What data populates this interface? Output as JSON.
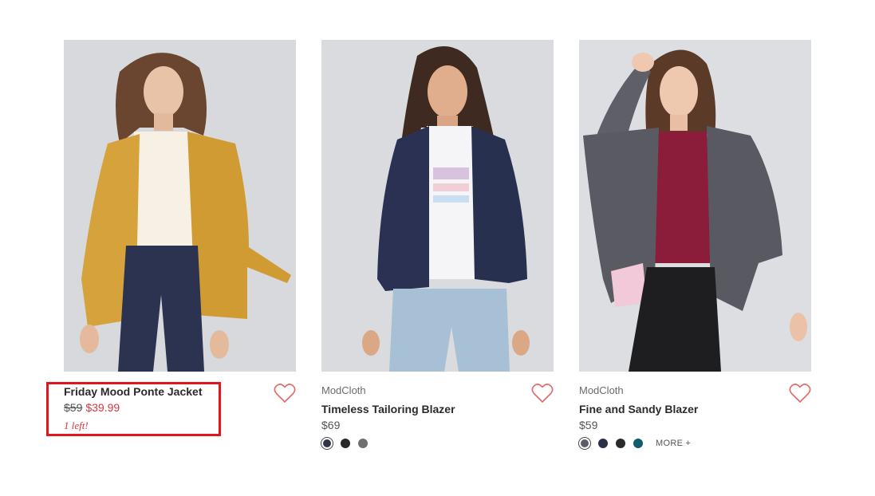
{
  "colors": {
    "sale_red": "#d9363e",
    "highlight_red": "#e0161e",
    "heart_stroke": "#e06a6a"
  },
  "products": [
    {
      "brand": "",
      "name": "Friday Mood Ponte Jacket",
      "original_price": "$59",
      "sale_price": "$39.99",
      "stock_note": "1 left!",
      "image": "model-in-mustard-jacket",
      "favorite_icon": "heart-outline-icon"
    },
    {
      "brand": "ModCloth",
      "name": "Timeless Tailoring Blazer",
      "price": "$69",
      "image": "model-in-navy-blazer",
      "favorite_icon": "heart-outline-icon",
      "swatches": [
        "#2f3447",
        "#2a2a2a",
        "#6f6f6f"
      ]
    },
    {
      "brand": "ModCloth",
      "name": "Fine and Sandy Blazer",
      "price": "$59",
      "image": "model-in-gray-blazer",
      "favorite_icon": "heart-outline-icon",
      "swatches": [
        "#5c5c66",
        "#2c3148",
        "#2a2a2a",
        "#0f5c6b"
      ],
      "more_label": "MORE +"
    }
  ]
}
